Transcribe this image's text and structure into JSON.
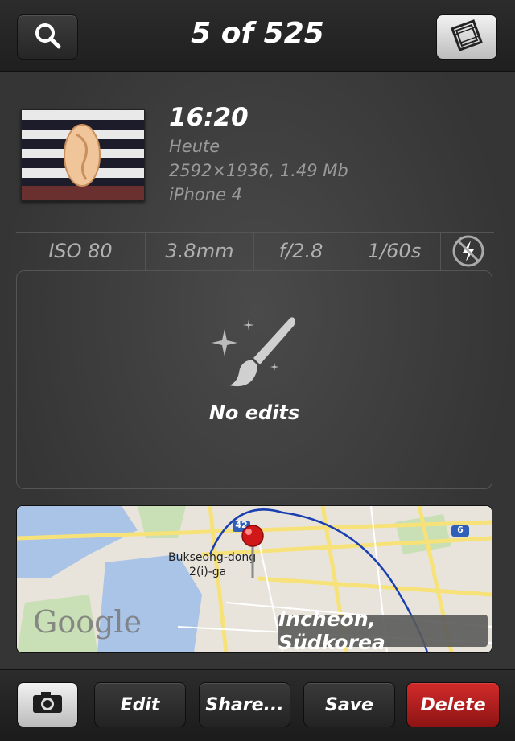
{
  "header": {
    "title": "5 of 525"
  },
  "photo": {
    "time": "16:20",
    "date": "Heute",
    "size": "2592×1936, 1.49 Mb",
    "device": "iPhone 4"
  },
  "exif": {
    "iso": "ISO 80",
    "focal": "3.8mm",
    "aperture": "f/2.8",
    "shutter": "1/60s"
  },
  "edits": {
    "label": "No edits"
  },
  "map": {
    "location": "Incheon, Südkorea",
    "provider": "Google",
    "labels": {
      "district": "Bukseong-dong",
      "district2": "2(i)-ga",
      "road_num1": "42",
      "road_num2": "6"
    }
  },
  "toolbar": {
    "edit": "Edit",
    "share": "Share...",
    "save": "Save",
    "delete": "Delete"
  },
  "colors": {
    "delete": "#b51d1d",
    "background": "#3a3a3a"
  },
  "icons": [
    "search-icon",
    "filmstrip-icon",
    "flash-off-icon",
    "brush-icon",
    "camera-icon",
    "map-pin-icon"
  ]
}
